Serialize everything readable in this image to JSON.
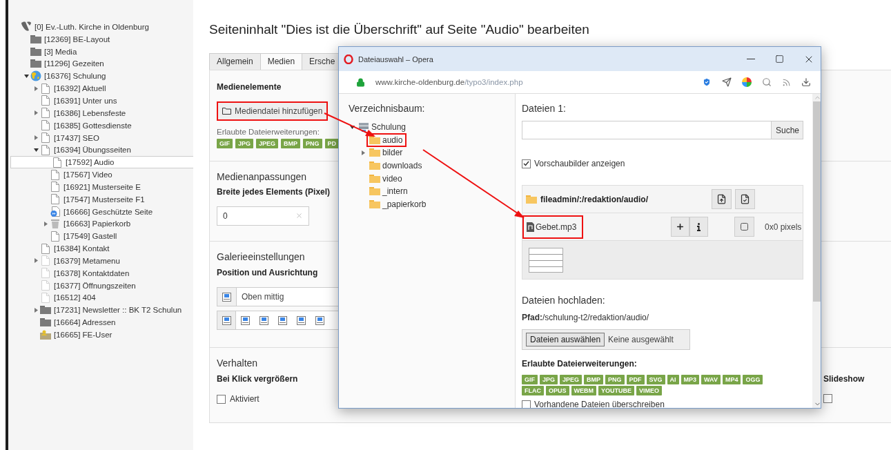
{
  "page_tree": [
    {
      "label": "[0] Ev.-Luth. Kirche in Oldenburg",
      "kind": "root",
      "selected": false,
      "children": [
        {
          "label": "[12369] BE-Layout",
          "kind": "folder",
          "selected": false
        },
        {
          "label": "[3] Media",
          "kind": "folder",
          "selected": false
        },
        {
          "label": "[11296] Gezeiten",
          "kind": "folder",
          "selected": false
        },
        {
          "label": "[16376] Schulung",
          "kind": "globe",
          "expanded": true,
          "selected": false,
          "children": [
            {
              "label": "[16392] Aktuell",
              "kind": "page",
              "expanded": false,
              "selected": false
            },
            {
              "label": "[16391] Unter uns",
              "kind": "page",
              "selected": false
            },
            {
              "label": "[16386] Lebensfeste",
              "kind": "page",
              "expanded": false,
              "selected": false
            },
            {
              "label": "[16385] Gottesdienste",
              "kind": "page",
              "selected": false
            },
            {
              "label": "[17437] SEO",
              "kind": "page",
              "expanded": false,
              "selected": false
            },
            {
              "label": "[16394] Übungsseiten",
              "kind": "page",
              "expanded": true,
              "selected": false,
              "children": [
                {
                  "label": "[17592] Audio",
                  "kind": "page",
                  "selected": true
                },
                {
                  "label": "[17567] Video",
                  "kind": "page",
                  "selected": false
                },
                {
                  "label": "[16921] Musterseite E",
                  "kind": "page",
                  "selected": false
                },
                {
                  "label": "[17547] Musterseite F1",
                  "kind": "page",
                  "selected": false
                },
                {
                  "label": "[16666] Geschützte Seite",
                  "kind": "protected",
                  "selected": false
                },
                {
                  "label": "[16663] Papierkorb",
                  "kind": "trash",
                  "expanded": false,
                  "selected": false
                },
                {
                  "label": "[17549] Gastell",
                  "kind": "page",
                  "selected": false
                }
              ]
            },
            {
              "label": "[16384] Kontakt",
              "kind": "page",
              "selected": false
            },
            {
              "label": "[16379] Metamenu",
              "kind": "hidden",
              "expanded": false,
              "selected": false
            },
            {
              "label": "[16378] Kontaktdaten",
              "kind": "hidden",
              "selected": false
            },
            {
              "label": "[16377] Öffnungszeiten",
              "kind": "hidden",
              "selected": false
            },
            {
              "label": "[16512] 404",
              "kind": "hidden",
              "selected": false
            },
            {
              "label": "[17231] Newsletter :: BK T2 Schulun",
              "kind": "folder",
              "expanded": false,
              "selected": false
            },
            {
              "label": "[16664] Adressen",
              "kind": "folder",
              "selected": false
            },
            {
              "label": "[16665] FE-User",
              "kind": "userfolder",
              "selected": false
            }
          ]
        }
      ]
    }
  ],
  "title": "Seiteninhalt \"Dies ist die Überschrift\" auf Seite \"Audio\" bearbeiten",
  "tabs": [
    {
      "label": "Allgemein",
      "selected": false
    },
    {
      "label": "Medien",
      "selected": true
    },
    {
      "label": "Ersche",
      "selected": false
    }
  ],
  "media_elements": {
    "heading": "Medienelemente",
    "add_button": "Mediendatei hinzufügen",
    "annotated": true,
    "allowed_label": "Erlaubte Dateierweiterungen:",
    "extensions": [
      "GIF",
      "JPG",
      "JPEG",
      "BMP",
      "PNG",
      "PD"
    ]
  },
  "media_adjustments": {
    "heading": "Medienanpassungen",
    "field_label": "Breite jedes Elements (Pixel)",
    "value": "0"
  },
  "gallery": {
    "heading": "Galerieeinstellungen",
    "field_label": "Position und Ausrichtung",
    "position_value": "Oben mittig",
    "positions": [
      {
        "selected": true
      },
      {
        "selected": false
      },
      {
        "selected": false
      },
      {
        "selected": false
      },
      {
        "selected": false
      },
      {
        "selected": false
      }
    ]
  },
  "behavior": {
    "heading": "Verhalten",
    "field_label": "Bei Klick vergrößern",
    "checkbox_label": "Aktiviert",
    "checked": false,
    "right_label": "Slideshow",
    "right_checked": false
  },
  "popup": {
    "title": "Dateiauswahl – Opera",
    "url_host": "www.kirche-oldenburg.de",
    "url_path": "/typo3/index.php",
    "tree_heading": "Verzeichnisbaum:",
    "folder_tree": [
      {
        "label": "Schulung",
        "kind": "storage",
        "expanded": true,
        "annotated": false,
        "children": [
          {
            "label": "audio",
            "kind": "folder",
            "annotated": true
          },
          {
            "label": "bilder",
            "kind": "folder",
            "expanded": false,
            "annotated": false
          },
          {
            "label": "downloads",
            "kind": "folder",
            "annotated": false
          },
          {
            "label": "video",
            "kind": "folder",
            "annotated": false
          },
          {
            "label": "_intern",
            "kind": "folder",
            "annotated": false
          },
          {
            "label": "_papierkorb",
            "kind": "folder",
            "annotated": false
          }
        ]
      }
    ],
    "files_heading": "Dateien 1:",
    "search_button": "Suche",
    "thumbnails": {
      "label": "Vorschaubilder anzeigen",
      "checked": true
    },
    "folder_path": "fileadmin/:/redaktion/audio/",
    "files": [
      {
        "name": "Gebet.mp3",
        "size": "0x0 pixels",
        "annotated": true
      }
    ],
    "upload_heading": "Dateien hochladen:",
    "upload_path": "**Pfad:**/schulung-t2/redaktion/audio/",
    "choose_button": "Dateien auswählen",
    "no_file": "Keine ausgewählt",
    "extensions_label": "Erlaubte Dateierweiterungen:",
    "extensions": [
      "GIF",
      "JPG",
      "JPEG",
      "BMP",
      "PNG",
      "PDF",
      "SVG",
      "AI",
      "MP3",
      "WAV",
      "MP4",
      "OGG",
      "FLAC",
      "OPUS",
      "WEBM",
      "YOUTUBE",
      "VIMEO"
    ],
    "overwrite": {
      "label": "Vorhandene Dateien überschreiben",
      "checked": false
    }
  }
}
